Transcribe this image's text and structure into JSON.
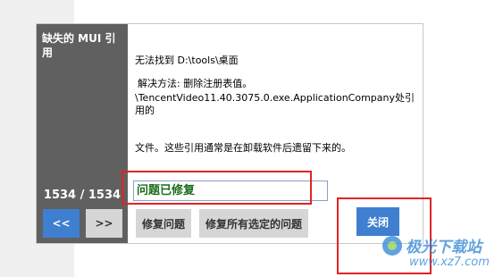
{
  "dialog": {
    "panel_title": "缺失的 MUI 引用",
    "counter": "1534 / 1534",
    "prev_label": "<<",
    "next_label": ">>",
    "message_line1": "无法找到 D:\\tools\\桌面",
    "message_line2": "\\TencentVideo11.40.3075.0.exe.ApplicationCompany处引用的",
    "message_line3": "文件。这些引用通常是在卸载软件后遗留下来的。",
    "resolution": "解决方法: 删除注册表值。",
    "status": "问题已修复",
    "fix_label": "修复问题",
    "fix_all_label": "修复所有选定的问题",
    "close_label": "关闭"
  },
  "watermark": {
    "title": "极光下载站",
    "url": "www.xz7.com"
  },
  "colors": {
    "panel": "#606060",
    "accent_blue": "#3f7fd0",
    "status_green": "#1a6b1a",
    "highlight_red": "#e02424"
  }
}
